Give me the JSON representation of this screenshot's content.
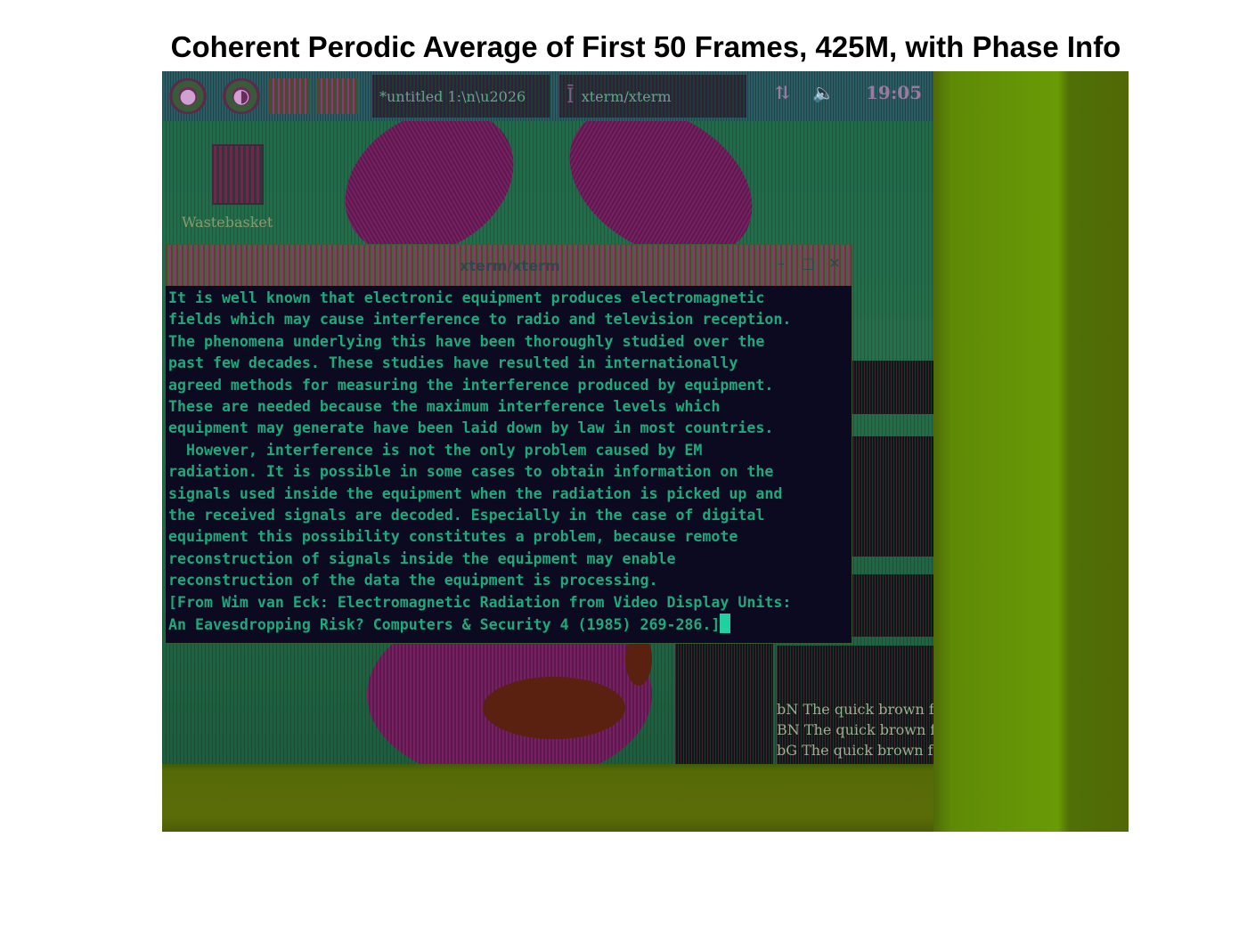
{
  "figure": {
    "title": "Coherent Perodic Average of First 50 Frames, 425M, with Phase Info"
  },
  "taskbar": {
    "icons": [
      "gnome-foot-icon",
      "globe-icon",
      "folder-icon",
      "image-icon",
      "window-icon"
    ],
    "task_1_label": "*untitled 1:\\n\\u2026",
    "task_2_label": "xterm/xterm",
    "clock": "19:05"
  },
  "desktop": {
    "trash_label": "Wastebasket"
  },
  "terminal": {
    "title": "xterm/xterm",
    "lines": [
      "It is well known that electronic equipment produces electromagnetic",
      "fields which may cause interference to radio and television reception.",
      "The phenomena underlying this have been thoroughly studied over the",
      "past few decades. These studies have resulted in internationally",
      "agreed methods for measuring the interference produced by equipment.",
      "These are needed because the maximum interference levels which",
      "equipment may generate have been laid down by law in most countries.",
      "  However, interference is not the only problem caused by EM",
      "radiation. It is possible in some cases to obtain information on the",
      "signals used inside the equipment when the radiation is picked up and",
      "the received signals are decoded. Especially in the case of digital",
      "equipment this possibility constitutes a problem, because remote",
      "reconstruction of signals inside the equipment may enable",
      "reconstruction of the data the equipment is processing.",
      "[From Wim van Eck: Electromagnetic Radiation from Video Display Units:",
      "An Eavesdropping Risk? Computers & Security 4 (1985) 269-286.]"
    ]
  },
  "side_window": {
    "lines": [
      "bN The quick brown f",
      "BN The quick brown f",
      "bG The quick brown fo"
    ]
  }
}
